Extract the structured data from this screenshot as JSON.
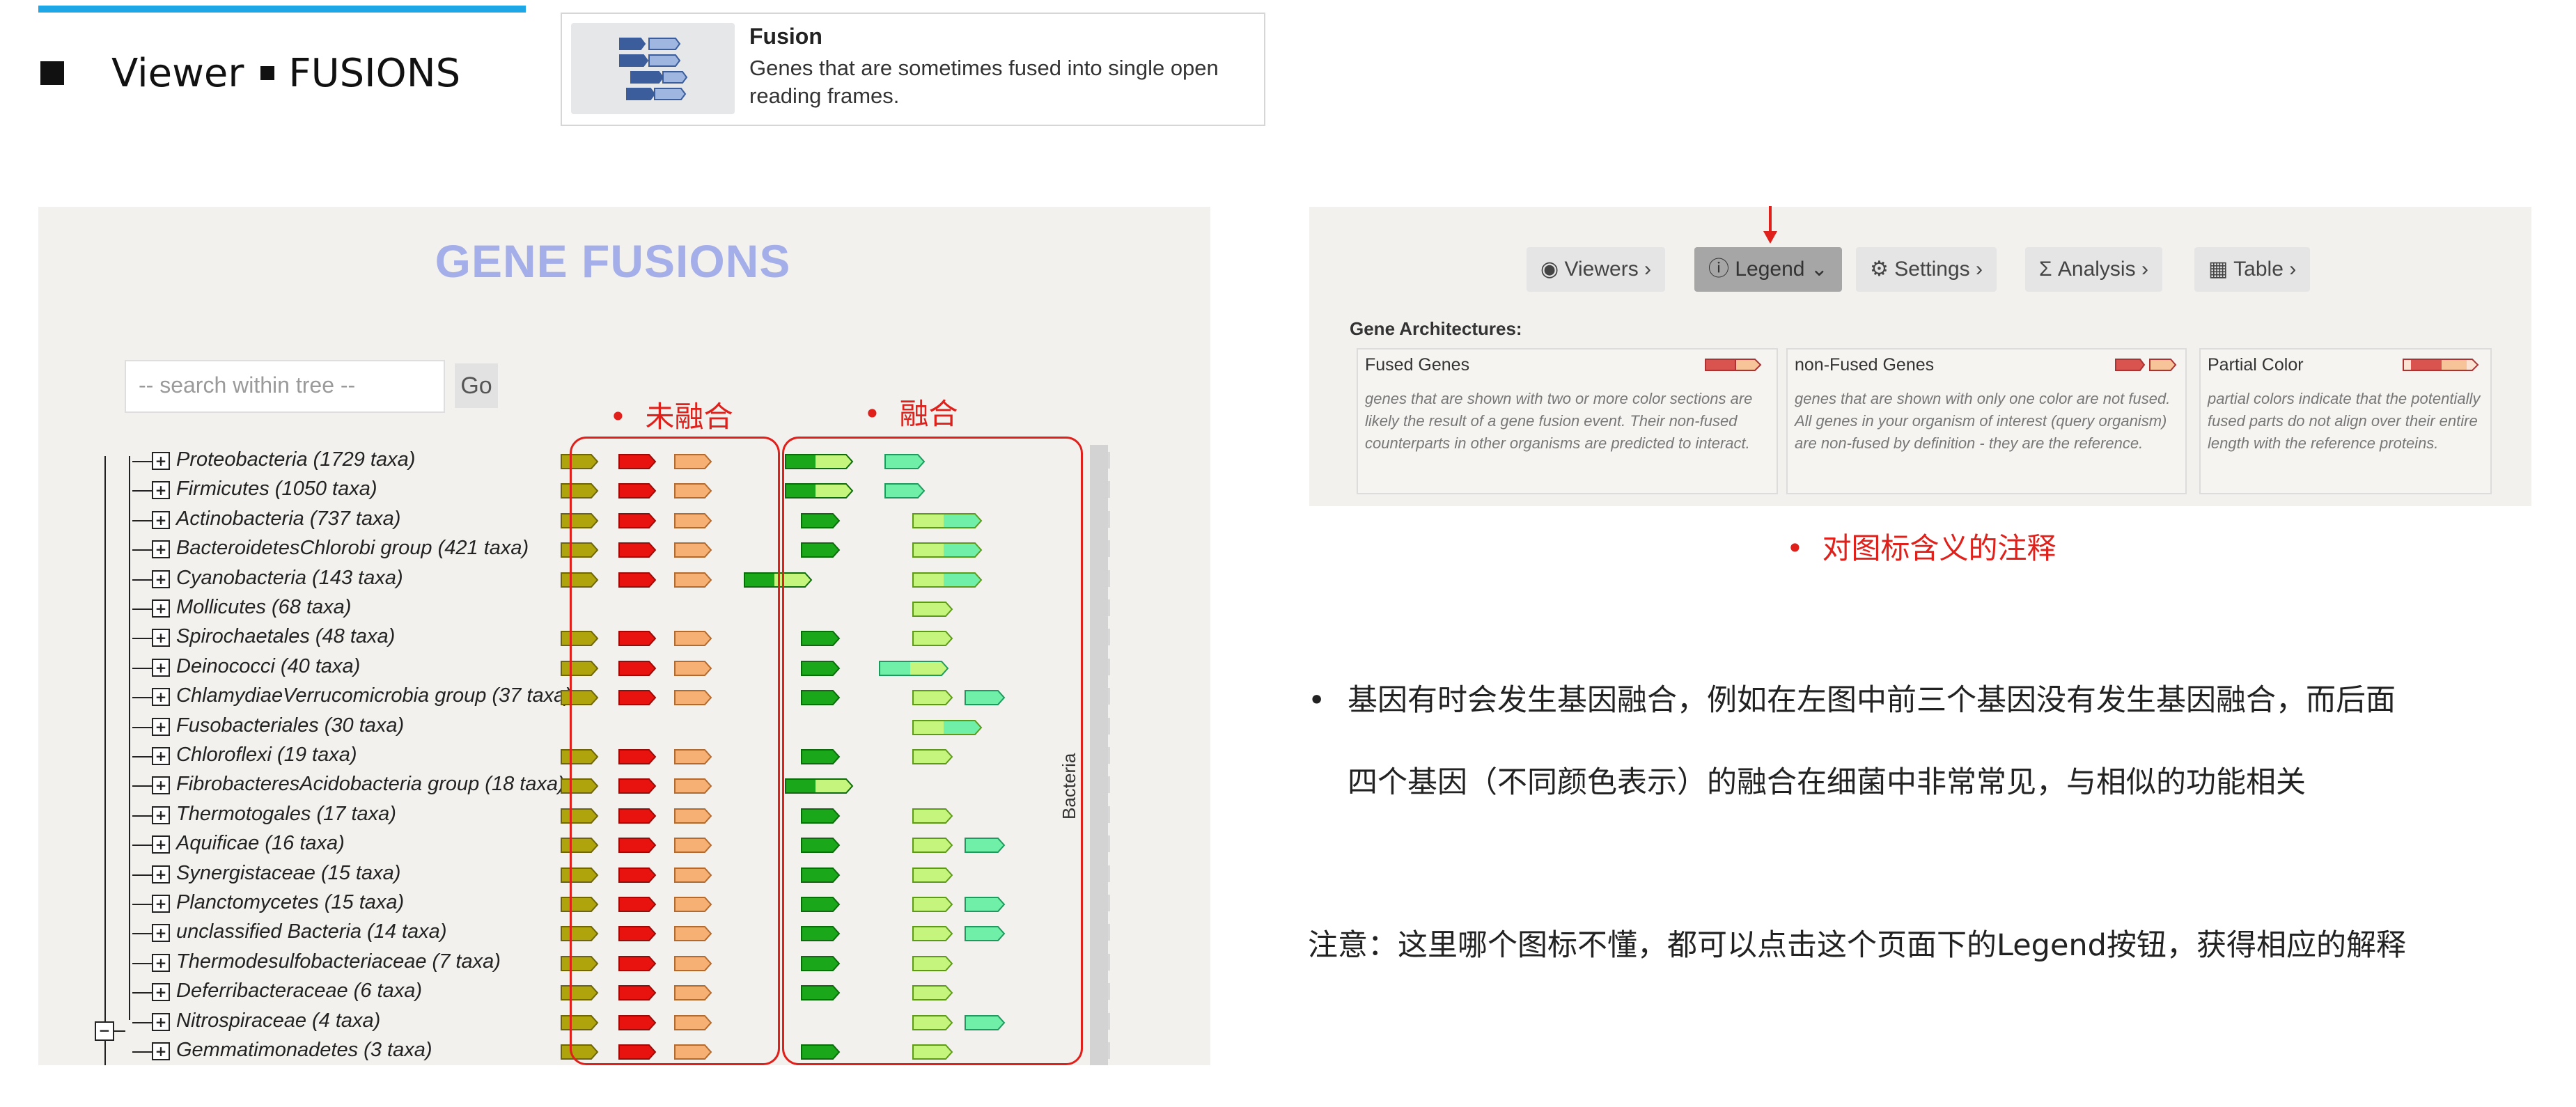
{
  "header": {
    "title_left": "Viewer",
    "title_right": "FUSIONS"
  },
  "card": {
    "title": "Fusion",
    "desc": "Genes that are sometimes fused into single open reading frames."
  },
  "gene_panel": {
    "title": "GENE FUSIONS",
    "search_placeholder": "-- search within tree --",
    "go_label": "Go",
    "label_unfused": "未融合",
    "label_fused": "融合",
    "side_label": "Bacteria",
    "rows": [
      "Proteobacteria (1729 taxa)",
      "Firmicutes (1050 taxa)",
      "Actinobacteria (737 taxa)",
      "BacteroidetesChlorobi group (421 taxa)",
      "Cyanobacteria (143 taxa)",
      "Mollicutes (68 taxa)",
      "Spirochaetales (48 taxa)",
      "Deinococci (40 taxa)",
      "ChlamydiaeVerrucomicrobia group (37 taxa)",
      "Fusobacteriales (30 taxa)",
      "Chloroflexi (19 taxa)",
      "FibrobacteresAcidobacteria group (18 taxa)",
      "Thermotogales (17 taxa)",
      "Aquificae (16 taxa)",
      "Synergistaceae (15 taxa)",
      "Planctomycetes (15 taxa)",
      "unclassified Bacteria (14 taxa)",
      "Thermodesulfobacteriaceae (7 taxa)",
      "Deferribacteraceae (6 taxa)",
      "Nitrospiraceae (4 taxa)",
      "Gemmatimonadetes (3 taxa)"
    ],
    "colors": {
      "olive": "#b0a40d",
      "red": "#e8130f",
      "orange": "#f7b073",
      "green": "#1aa81a",
      "lightgreen": "#c5f57d",
      "mint": "#6fefa8"
    }
  },
  "right_panel": {
    "nav": [
      {
        "label": "Viewers",
        "icon": "eye-icon"
      },
      {
        "label": "Legend",
        "icon": "info-icon"
      },
      {
        "label": "Settings",
        "icon": "gear-icon"
      },
      {
        "label": "Analysis",
        "icon": "sigma-icon"
      },
      {
        "label": "Table",
        "icon": "table-icon"
      }
    ],
    "ga_title": "Gene Architectures:",
    "legend": [
      {
        "title": "Fused Genes",
        "desc": "genes that are shown with two or more color sections are likely the result of a gene fusion event. Their non-fused counterparts in other organisms are predicted to interact."
      },
      {
        "title": "non-Fused Genes",
        "desc": "genes that are shown with only one color are not fused. All genes in your organism of interest (query organism) are non-fused by definition - they are the reference."
      },
      {
        "title": "Partial Color",
        "desc": "partial colors indicate that the potentially fused parts do not align over their entire length with the reference proteins."
      }
    ]
  },
  "notes": {
    "legend_caption": "对图标含义的注释",
    "para1_line1": "基因有时会发生基因融合，例如在左图中前三个基因没有发生基因融合，而后面",
    "para1_line2": "四个基因（不同颜色表示）的融合在细菌中非常常见，与相似的功能相关",
    "para2": "注意：这里哪个图标不懂，都可以点击这个页面下的Legend按钮，获得相应的解释"
  }
}
